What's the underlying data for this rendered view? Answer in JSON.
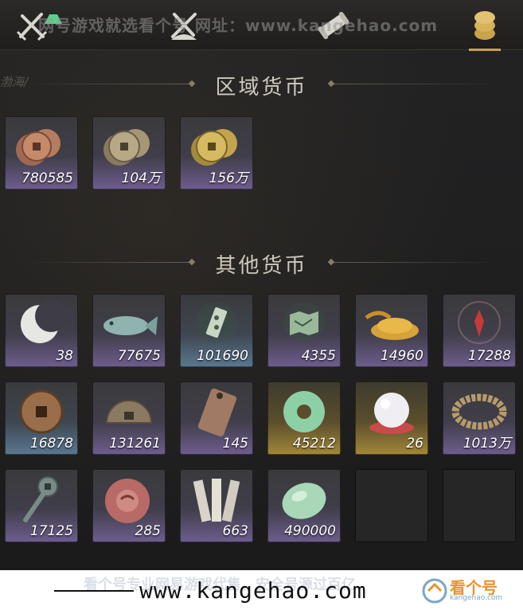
{
  "watermark_top": "网号游戏就选看个号   网址：www.kangehao.com",
  "breadcrumb": "渤海/",
  "tabs": [
    {
      "icon": "crossed-swords-icon",
      "active": false
    },
    {
      "icon": "crossed-tools-icon",
      "active": false
    },
    {
      "icon": "scroll-icon",
      "active": false
    },
    {
      "icon": "coin-stack-icon",
      "active": true
    }
  ],
  "sections": {
    "regional": {
      "title": "区域货币",
      "items": [
        {
          "icon": "copper-coins-icon",
          "qty": "780585",
          "rarity": "purple"
        },
        {
          "icon": "silver-coins-icon",
          "qty": "104万",
          "rarity": "purple"
        },
        {
          "icon": "gold-coins-icon",
          "qty": "156万",
          "rarity": "purple"
        }
      ]
    },
    "other": {
      "title": "其他货币",
      "items": [
        {
          "icon": "crescent-moon-icon",
          "qty": "38",
          "rarity": "purple"
        },
        {
          "icon": "jade-fish-icon",
          "qty": "77675",
          "rarity": "purple"
        },
        {
          "icon": "jade-token-icon",
          "qty": "101690",
          "rarity": "blue"
        },
        {
          "icon": "map-icon",
          "qty": "4355",
          "rarity": "purple"
        },
        {
          "icon": "grain-pile-icon",
          "qty": "14960",
          "rarity": "purple"
        },
        {
          "icon": "red-sigil-icon",
          "qty": "17288",
          "rarity": "purple"
        },
        {
          "icon": "bronze-coin-icon",
          "qty": "16878",
          "rarity": "blue"
        },
        {
          "icon": "half-coin-icon",
          "qty": "131261",
          "rarity": "purple"
        },
        {
          "icon": "bronze-plaque-icon",
          "qty": "145",
          "rarity": "purple"
        },
        {
          "icon": "jade-ring-icon",
          "qty": "45212",
          "rarity": "gold"
        },
        {
          "icon": "pearl-icon",
          "qty": "26",
          "rarity": "gold"
        },
        {
          "icon": "coin-string-icon",
          "qty": "1013万",
          "rarity": "purple"
        },
        {
          "icon": "key-coin-icon",
          "qty": "17125",
          "rarity": "purple"
        },
        {
          "icon": "red-seal-icon",
          "qty": "285",
          "rarity": "purple"
        },
        {
          "icon": "bamboo-slips-icon",
          "qty": "663",
          "rarity": "purple"
        },
        {
          "icon": "jade-stone-icon",
          "qty": "490000",
          "rarity": "purple"
        },
        {
          "icon": "empty-slot",
          "qty": "",
          "rarity": "empty"
        },
        {
          "icon": "empty-slot",
          "qty": "",
          "rarity": "empty"
        }
      ]
    }
  },
  "banner": {
    "ghost_text": "看个号专业网易游戏代售，安全号源过百亿",
    "site": "www.kangehao.com",
    "logo_text": "看个号",
    "logo_sub": "kangehao.com"
  }
}
